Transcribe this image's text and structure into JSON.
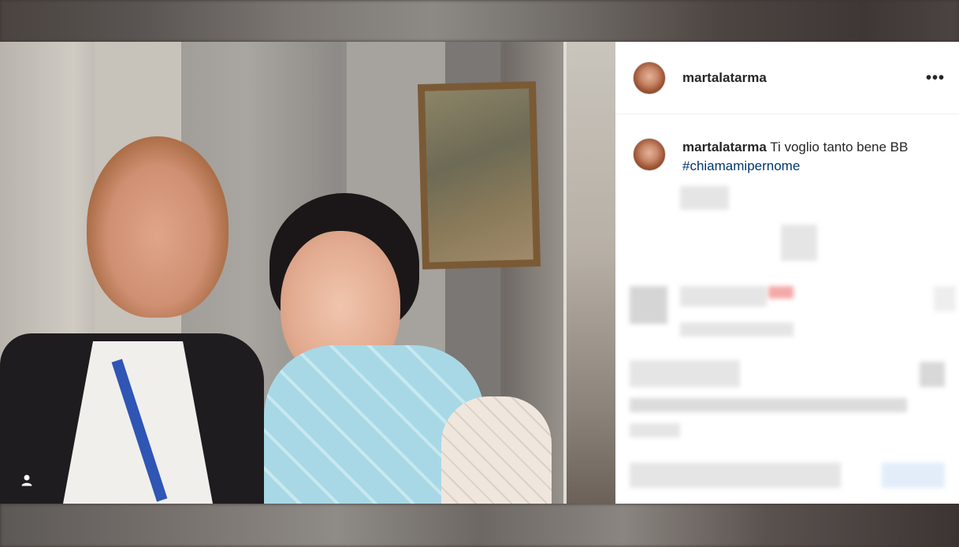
{
  "post": {
    "username": "martalatarma",
    "more_label": "•••",
    "caption": {
      "username": "martalatarma",
      "text": " Ti voglio tanto bene BB",
      "hashtag": "#chiamamipernome"
    }
  },
  "icons": {
    "tag": "user-tag-icon",
    "more": "more-options-icon"
  },
  "colors": {
    "text": "#262626",
    "hashtag": "#00376b",
    "divider": "#efefef"
  }
}
